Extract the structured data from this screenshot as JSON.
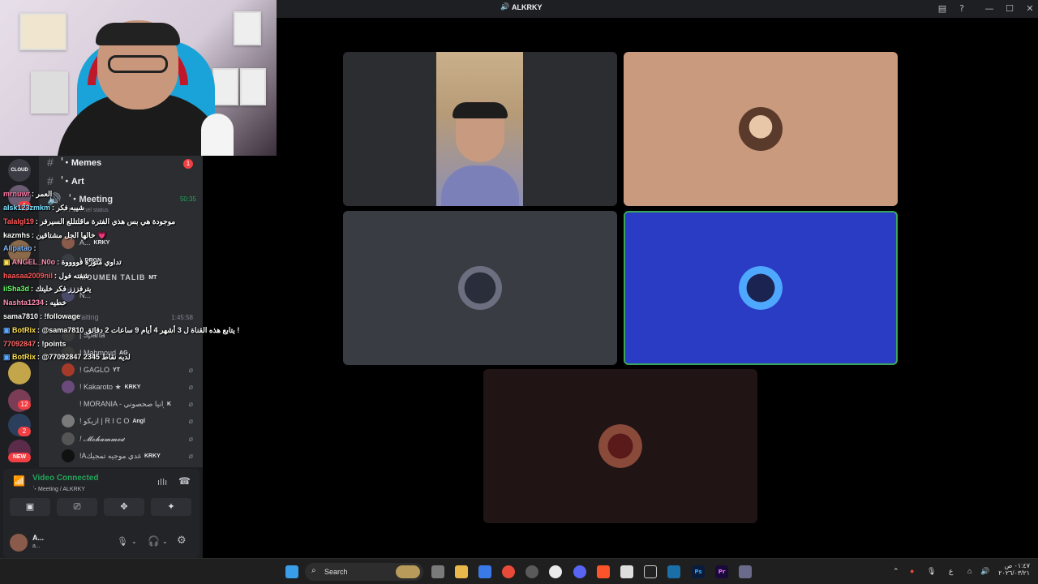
{
  "window": {
    "title": "ALKRKY"
  },
  "colors": {
    "connected": "#23a559",
    "accent": "#5865f2",
    "badge": "#f23f43",
    "active_tile": "#2a3cc4",
    "peach_tile": "#c99a7d"
  },
  "sidebar": {
    "server_labels": [
      "CLOUD",
      "NEW"
    ],
    "server_badges": [
      "1",
      "12",
      "2"
    ],
    "channels": [
      {
        "icon": "hash-icon",
        "name": "ٰ ・Memes"
      },
      {
        "icon": "hash-icon",
        "name": "ٰ ・Art"
      },
      {
        "icon": "speaker-icon",
        "name": "ٰ ・Meeting",
        "time": "50:35"
      }
    ],
    "channel_status": "Set channel status",
    "waiting": {
      "name": "Waiting",
      "time": "1:45:58"
    },
    "members": [
      {
        "name": "A...",
        "badge": "KRKY"
      },
      {
        "name": "!",
        "badge": "DRGN"
      },
      {
        "name": "MOUMEN TALIB",
        "badge": "MT"
      },
      {
        "name": "N...",
        "badge": ""
      },
      {
        "name": "| Sparta",
        "badge": ""
      },
      {
        "name": "! Mahmoud",
        "badge": "AG"
      },
      {
        "name": "! GAGLO",
        "badge": "YT"
      },
      {
        "name": "! Kakaroto ★",
        "badge": "KRKY"
      },
      {
        "name": "! MORANIA - مورانيا صحصوني",
        "badge": "K"
      },
      {
        "name": "! ازيكو | R I C O",
        "badge": "Angl"
      },
      {
        "name": "! 𝓜𝓸𝓱𝓪𝓶𝓶𝓮𝓭",
        "badge": ""
      },
      {
        "name": "!Aعدي موجيه تمجيكH!",
        "badge": "KRKY"
      }
    ]
  },
  "chat": [
    {
      "user": "mrnuwr",
      "color": "#ff7aa8",
      "text": ": العمر"
    },
    {
      "user": "alsk123zmkm",
      "color": "#7de3ff",
      "text": ": شيبه فكر"
    },
    {
      "user": "Talalgl19",
      "color": "#ff5a5a",
      "text": ": موجودة هي بس هذي الفترة ماقلتللع السيرفر"
    },
    {
      "user": "kazmhs",
      "color": "#ffffff",
      "text": ": خالها الجل مشتاقين 💗"
    },
    {
      "user": "Alipatao",
      "color": "#7db7ff",
      "text": ":"
    },
    {
      "user": "ANGEL_N0o",
      "color": "#ff8fb0",
      "text": ": تداوي منورة فووووة"
    },
    {
      "user": "haasaa2009nil",
      "color": "#ff5a5a",
      "text": ": شفته فول"
    },
    {
      "user": "iiSha3d",
      "color": "#6bff6b",
      "text": ": يترفززز فكر خليتك"
    },
    {
      "user": "Nashta1234",
      "color": "#ff8fb0",
      "text": ": خطيه"
    },
    {
      "user": "sama7810",
      "color": "#ffffff",
      "text": ": !followage"
    },
    {
      "user": "BotRix",
      "color": "#ffe14d",
      "text": ": @sama7810 يتابع هذه القناة ل 3 أشهر 4 أيام 9 ساعات 2 دقائق !"
    },
    {
      "user": "77092847",
      "color": "#ff6b6b",
      "text": ": !points"
    },
    {
      "user": "BotRix",
      "color": "#ffe14d",
      "text": ": @77092847 لديه نقاط 2345"
    }
  ],
  "voice": {
    "status": "Video Connected",
    "location": "ٰ・Meeting / ALKRKY",
    "username": "A...",
    "user_sub": "a..."
  },
  "taskbar": {
    "search_placeholder": "Search",
    "time": "٠١:٤٧ ص",
    "date": "٢٠٢٦/٠٣/٢١",
    "lang": "ع"
  }
}
